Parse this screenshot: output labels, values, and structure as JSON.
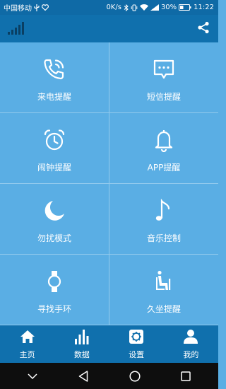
{
  "status_bar": {
    "carrier": "中国移动",
    "net_speed": "0K/s",
    "battery": "30%",
    "time": "11:22"
  },
  "header": {
    "signal_icon": "signal-bars-icon",
    "share_icon": "share-icon"
  },
  "features": [
    {
      "label": "来电提醒",
      "icon": "phone-ringing-icon"
    },
    {
      "label": "短信提醒",
      "icon": "message-icon"
    },
    {
      "label": "闹钟提醒",
      "icon": "alarm-clock-icon"
    },
    {
      "label": "APP提醒",
      "icon": "bell-icon"
    },
    {
      "label": "勿扰模式",
      "icon": "moon-icon"
    },
    {
      "label": "音乐控制",
      "icon": "music-note-icon"
    },
    {
      "label": "寻找手环",
      "icon": "watch-icon"
    },
    {
      "label": "久坐提醒",
      "icon": "sitting-person-icon"
    }
  ],
  "bottom_nav": [
    {
      "label": "主页",
      "icon": "home-icon"
    },
    {
      "label": "数据",
      "icon": "bar-chart-icon"
    },
    {
      "label": "设置",
      "icon": "settings-icon"
    },
    {
      "label": "我的",
      "icon": "user-icon"
    }
  ],
  "colors": {
    "background": "#5aaee4",
    "header": "#1070ad",
    "status_bar": "#0f6aa6",
    "system_nav": "#0e0e0e"
  }
}
